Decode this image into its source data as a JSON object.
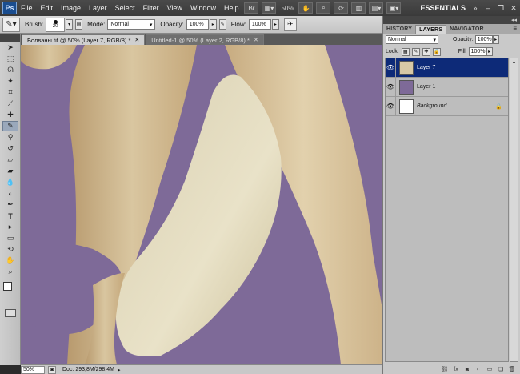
{
  "app": {
    "logo_text": "Ps"
  },
  "menu": {
    "items": [
      "File",
      "Edit",
      "Image",
      "Layer",
      "Select",
      "Filter",
      "View",
      "Window",
      "Help"
    ],
    "bridge_label": "Br",
    "zoom_value": "50%",
    "workspace_label": "ESSENTIALS"
  },
  "options": {
    "brush_label": "Brush:",
    "brush_size": "20",
    "mode_label": "Mode:",
    "mode_value": "Normal",
    "opacity_label": "Opacity:",
    "opacity_value": "100%",
    "flow_label": "Flow:",
    "flow_value": "100%"
  },
  "tabs": [
    {
      "label": "Болваны.tif @ 50% (Layer 7, RGB/8) *",
      "active": true
    },
    {
      "label": "Untitled-1 @ 50% (Layer 2, RGB/8) *",
      "active": false
    }
  ],
  "status": {
    "zoom": "50%",
    "doc_info": "Doc: 293,8M/298,4M"
  },
  "panel": {
    "tabs": [
      "HISTORY",
      "LAYERS",
      "NAVIGATOR"
    ],
    "active_tab": "LAYERS",
    "blend_mode": "Normal",
    "opacity_label": "Opacity:",
    "opacity_value": "100%",
    "lock_label": "Lock:",
    "fill_label": "Fill:",
    "fill_value": "100%",
    "layers": [
      {
        "name": "Layer 7",
        "selected": true,
        "italic": false,
        "locked": false
      },
      {
        "name": "Layer 1",
        "selected": false,
        "italic": false,
        "locked": false
      },
      {
        "name": "Background",
        "selected": false,
        "italic": true,
        "locked": true
      }
    ]
  },
  "colors": {
    "canvas_bg": "#7e6a98",
    "skin": "#d8c9a6",
    "selection": "#0d2a78"
  }
}
